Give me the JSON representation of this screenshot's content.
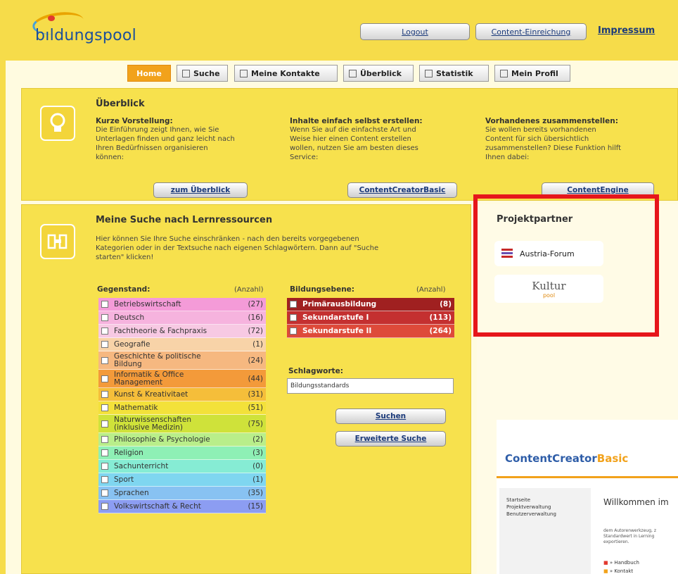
{
  "logo": {
    "text_main": "bıldungspool"
  },
  "header": {
    "logout": "Logout",
    "content_submit": "Content-Einreichung",
    "impressum": "Impressum"
  },
  "tabs": [
    {
      "label": "Home"
    },
    {
      "label": "Suche"
    },
    {
      "label": "Meine Kontakte"
    },
    {
      "label": "Überblick"
    },
    {
      "label": "Statistik"
    },
    {
      "label": "Mein Profil"
    }
  ],
  "overview": {
    "title": "Überblick",
    "cols": [
      {
        "heading": "Kurze Vorstellung:",
        "line1": "Die Einführung zeigt Ihnen, wie Sie",
        "line2": "Unterlagen finden und ganz leicht nach",
        "line3": "Ihren Bedürfnissen organisieren",
        "line4": "können:",
        "button": "zum Überblick"
      },
      {
        "heading": "Inhalte einfach selbst erstellen:",
        "line1": "Wenn Sie auf die einfachste Art und",
        "line2": "Weise hier einen Content erstellen",
        "line3": "wollen, nutzen Sie am besten dieses",
        "line4": "Service:",
        "button": "ContentCreatorBasic"
      },
      {
        "heading": "Vorhandenes zusammenstellen:",
        "line1": "Sie wollen bereits vorhandenen",
        "line2": "Content für sich übersichtlich",
        "line3": "zusammenstellen? Diese Funktion hilft",
        "line4": "Ihnen dabei:",
        "button": "ContentEngine"
      }
    ]
  },
  "search": {
    "title": "Meine Suche nach Lernressourcen",
    "intro1": "Hier können Sie Ihre Suche einschränken - nach den bereits vorgegebenen",
    "intro2": "Kategorien oder in der Textsuche nach eigenen Schlagwörtern. Dann auf \"Suche",
    "intro3": "starten\" klicken!",
    "subject_header": "Gegenstand:",
    "count_header": "(Anzahl)",
    "subjects": [
      {
        "label": "Betriebswirtschaft",
        "count": "(27)",
        "color": "#f49bd8"
      },
      {
        "label": "Deutsch",
        "count": "(16)",
        "color": "#f6b3de"
      },
      {
        "label": "Fachtheorie & Fachpraxis",
        "count": "(72)",
        "color": "#f7c9e3"
      },
      {
        "label": "Geografie",
        "count": "(1)",
        "color": "#f8d3a8"
      },
      {
        "label": "Geschichte & politische",
        "label2": "Bildung",
        "count": "(24)",
        "color": "#f6b880"
      },
      {
        "label": "Informatik & Office",
        "label2": "Management",
        "count": "(44)",
        "color": "#f39a3a"
      },
      {
        "label": "Kunst & Kreativitaet",
        "count": "(31)",
        "color": "#f5be3a"
      },
      {
        "label": "Mathematik",
        "count": "(51)",
        "color": "#f3e13a"
      },
      {
        "label": "Naturwissenschaften",
        "label2": "(inklusive Medizin)",
        "count": "(75)",
        "color": "#cfe23a"
      },
      {
        "label": "Philosophie & Psychologie",
        "count": "(2)",
        "color": "#b9ee8a"
      },
      {
        "label": "Religion",
        "count": "(3)",
        "color": "#8ef0b5"
      },
      {
        "label": "Sachunterricht",
        "count": "(0)",
        "color": "#86ecd4"
      },
      {
        "label": "Sport",
        "count": "(1)",
        "color": "#7fd6f0"
      },
      {
        "label": "Sprachen",
        "count": "(35)",
        "color": "#88c2f2"
      },
      {
        "label": "Volkswirtschaft & Recht",
        "count": "(15)",
        "color": "#8c9df2"
      }
    ],
    "level_header": "Bildungsebene:",
    "levels": [
      {
        "label": "Primärausbildung",
        "count": "(8)",
        "color": "#a02020"
      },
      {
        "label": "Sekundarstufe I",
        "count": "(113)",
        "color": "#c43030"
      },
      {
        "label": "Sekundarstufe II",
        "count": "(264)",
        "color": "#de4a3a"
      }
    ],
    "keywords_label": "Schlagworte:",
    "keywords_value": "Bildungsstandards",
    "search_button": "Suchen",
    "advanced_button": "Erweiterte Suche"
  },
  "partners": {
    "title": "Projektpartner",
    "austria": "Austria-Forum",
    "kultur": "Kultur",
    "kultur_sub": "pool"
  },
  "ccb": {
    "title_a": "ContentCreator",
    "title_b": "Basic",
    "nav1": "Startseite",
    "nav2": "Projektverwaltung",
    "nav3": "Benutzerverwaltung",
    "welcome": "Willkommen im",
    "body1": "dem Autorenwerkzeug, z",
    "body2": "Standardwert in Lerning",
    "body3": "exportieren.",
    "link1": "Handbuch",
    "link2": "Kontakt"
  },
  "colors": {
    "accent": "#f2a21b",
    "highlight": "#e6161b"
  }
}
